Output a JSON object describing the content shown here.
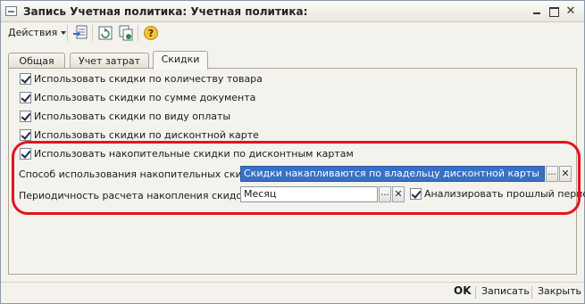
{
  "window": {
    "title": "Запись Учетная политика: Учетная политика:",
    "icon": "document-icon",
    "controls": [
      "minimize-icon",
      "maximize-icon",
      "close-icon"
    ]
  },
  "toolbar": {
    "actions_label": "Действия",
    "buttons": [
      "post-document-icon",
      "refresh-icon",
      "copy-icon",
      "help-icon"
    ]
  },
  "tabs": [
    {
      "label": "Общая",
      "active": false
    },
    {
      "label": "Учет затрат",
      "active": false
    },
    {
      "label": "Скидки",
      "active": true
    }
  ],
  "discounts": {
    "checkboxes": [
      {
        "label": "Использовать скидки по количеству товара",
        "checked": true
      },
      {
        "label": "Использовать скидки по сумме документа",
        "checked": true
      },
      {
        "label": "Использовать скидки по виду оплаты",
        "checked": true
      },
      {
        "label": "Использовать скидки по дисконтной карте",
        "checked": true
      },
      {
        "label": "Использовать накопительные скидки по дисконтным картам",
        "checked": true
      }
    ],
    "accumulation_method": {
      "label": "Способ использования накопительных скидок:",
      "value": "Скидки накапливаются по владельцу дисконтной карты"
    },
    "calculation_period": {
      "label": "Периодичность расчета накопления скидок:",
      "value": "Месяц"
    },
    "analyze_past_period": {
      "label": "Анализировать прошлый период",
      "checked": true
    },
    "select_glyph": "...",
    "clear_glyph": "✕"
  },
  "footer": {
    "ok": "OK",
    "save": "Записать",
    "close": "Закрыть"
  },
  "colors": {
    "highlight": "#e31420",
    "selection": "#3870c4"
  }
}
